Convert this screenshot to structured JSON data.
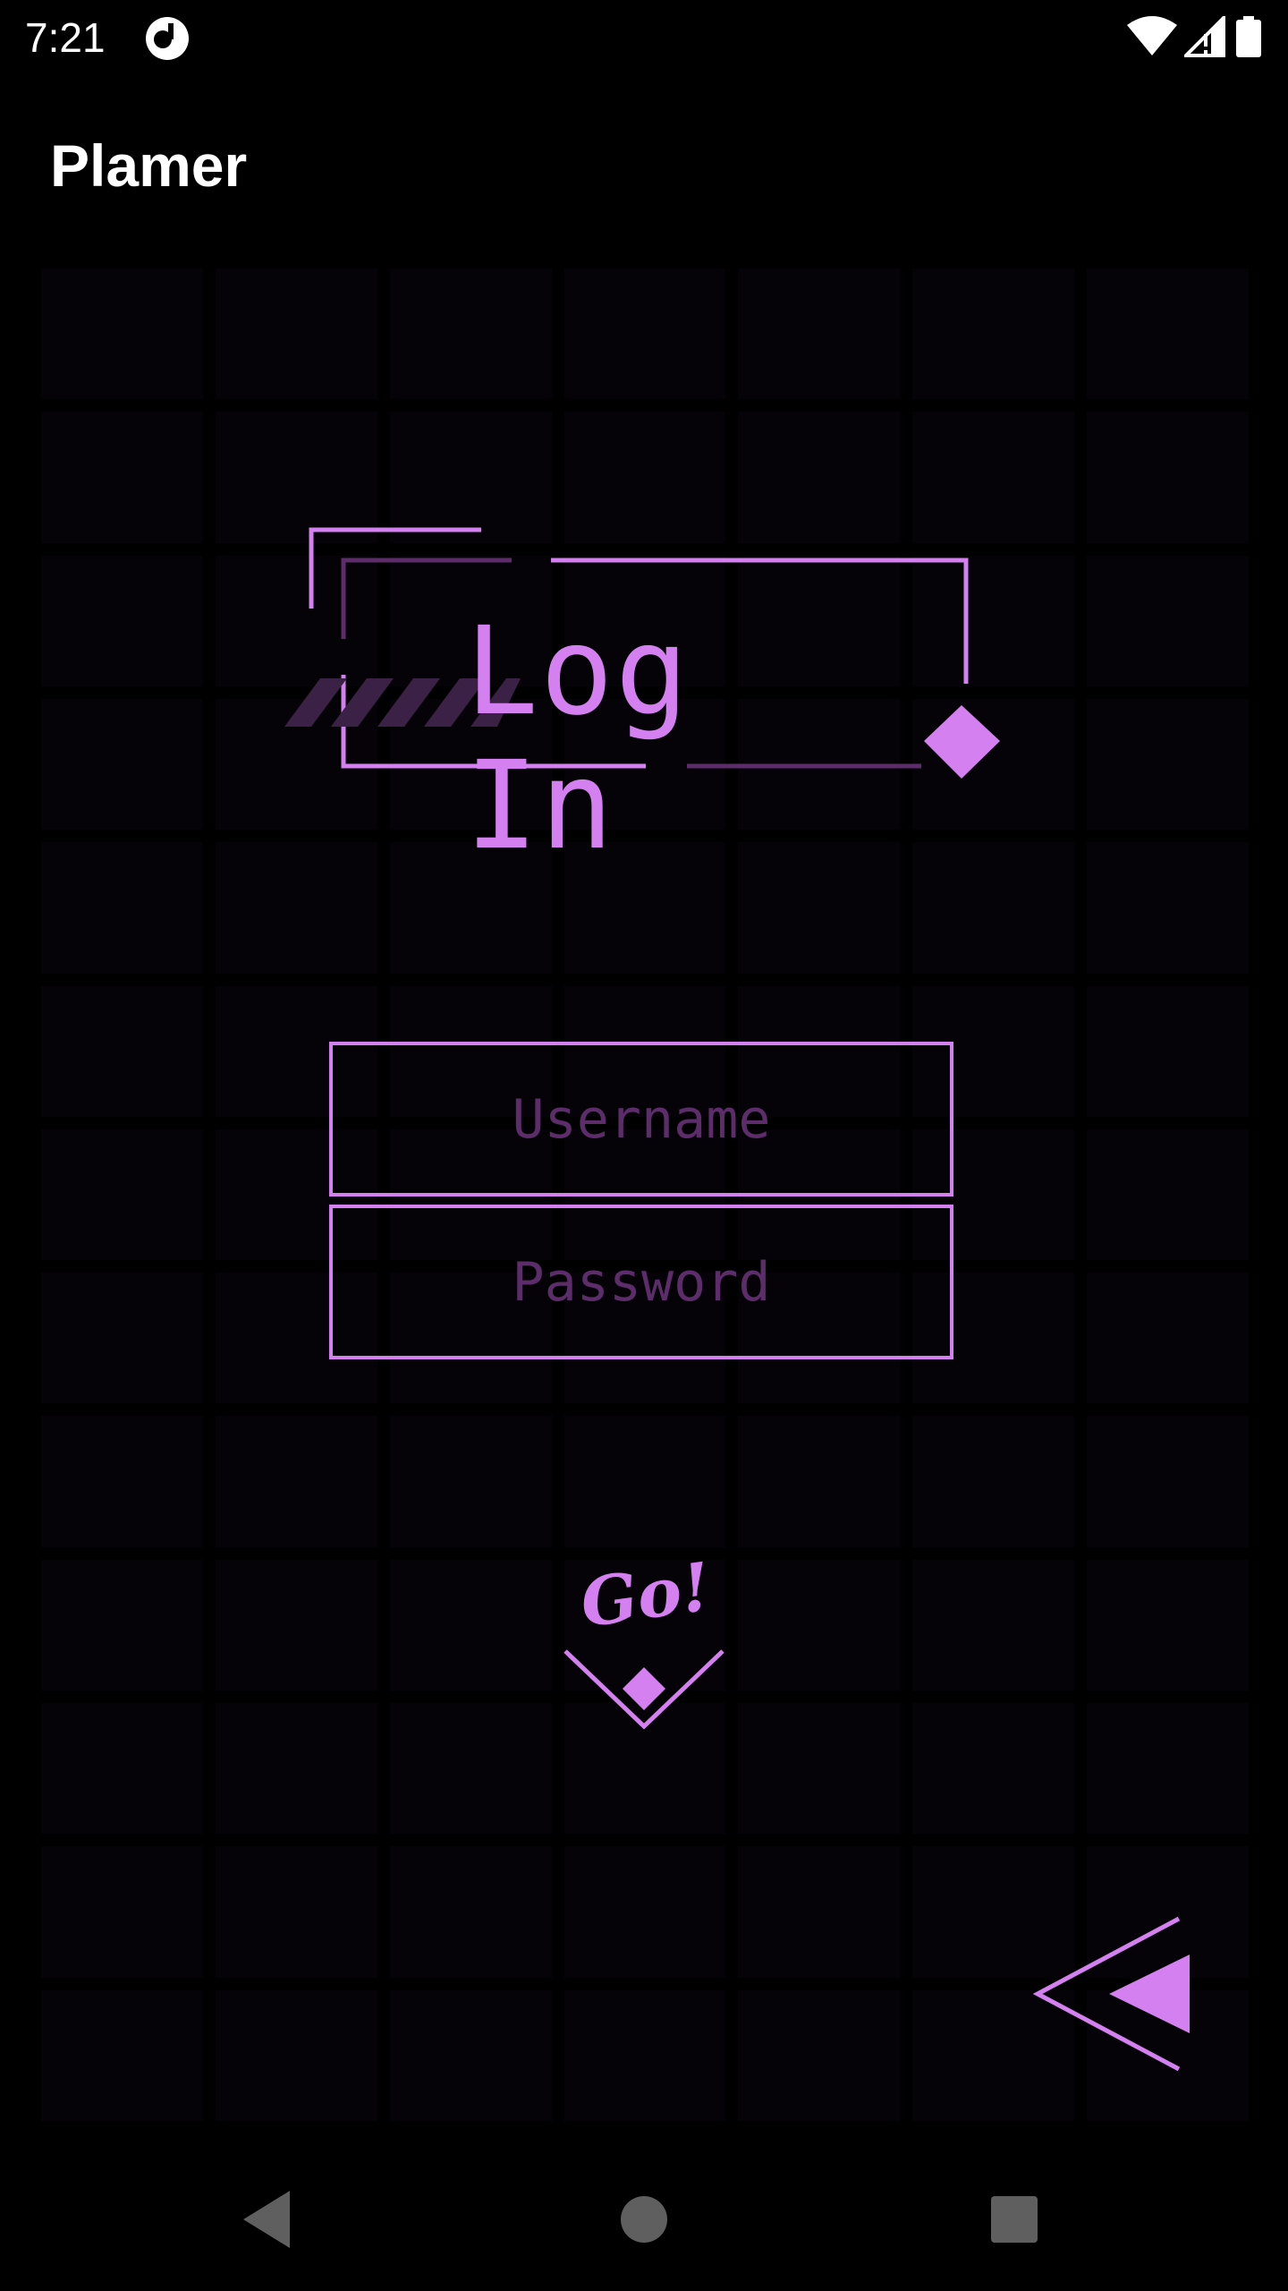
{
  "status_bar": {
    "time": "7:21",
    "app_icon": "app-notification-icon",
    "wifi_icon": "wifi-icon",
    "signal_icon": "cell-signal-icon",
    "battery_icon": "battery-icon"
  },
  "app_bar": {
    "title": "Plamer"
  },
  "login": {
    "heading": "Log In",
    "username_placeholder": "Username",
    "password_placeholder": "Password",
    "go_label": "Go!",
    "back_icon": "back-arrow-icon"
  },
  "nav_bar": {
    "back_icon": "nav-back-icon",
    "home_icon": "nav-home-icon",
    "recents_icon": "nav-recents-icon"
  },
  "colors": {
    "background": "#000000",
    "accent": "#d580f0",
    "accent_dim": "#5c2d6a",
    "grid_cell": "#050307",
    "text": "#ffffff"
  }
}
